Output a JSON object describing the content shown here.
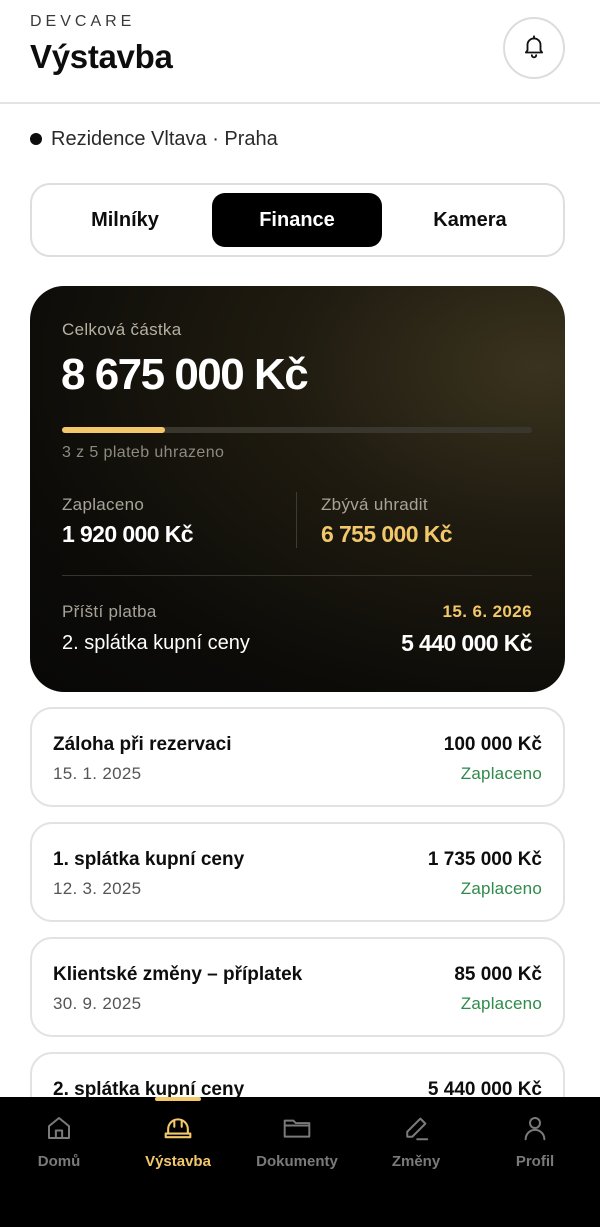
{
  "header": {
    "brand": "DEVCARE",
    "title": "Výstavba"
  },
  "project": {
    "name": "Rezidence Vltava · Praha"
  },
  "tabs": [
    {
      "label": "Milníky",
      "active": false
    },
    {
      "label": "Finance",
      "active": true
    },
    {
      "label": "Kamera",
      "active": false
    }
  ],
  "summary": {
    "total_label": "Celková částka",
    "total": "8 675 000 Kč",
    "progress_fraction": 0.22,
    "progress_text": "3 z 5 plateb uhrazeno",
    "paid_label": "Zaplaceno",
    "paid": "1 920 000 Kč",
    "remaining_label": "Zbývá uhradit",
    "remaining": "6 755 000 Kč",
    "next_label": "Příští platba",
    "next_date": "15. 6. 2026",
    "next_name": "2. splátka kupní ceny",
    "next_amount": "5 440 000 Kč"
  },
  "payments": [
    {
      "name": "Záloha při rezervaci",
      "date": "15. 1. 2025",
      "amount": "100 000 Kč",
      "status": "Zaplaceno"
    },
    {
      "name": "1. splátka kupní ceny",
      "date": "12. 3. 2025",
      "amount": "1 735 000 Kč",
      "status": "Zaplaceno"
    },
    {
      "name": "Klientské změny – příplatek",
      "date": "30. 9. 2025",
      "amount": "85 000 Kč",
      "status": "Zaplaceno"
    },
    {
      "name": "2. splátka kupní ceny",
      "date": "",
      "amount": "5 440 000 Kč",
      "status": ""
    }
  ],
  "nav": [
    {
      "label": "Domů",
      "icon": "home-icon",
      "active": false
    },
    {
      "label": "Výstavba",
      "icon": "hardhat-icon",
      "active": true
    },
    {
      "label": "Dokumenty",
      "icon": "folder-icon",
      "active": false
    },
    {
      "label": "Změny",
      "icon": "pencil-icon",
      "active": false
    },
    {
      "label": "Profil",
      "icon": "user-icon",
      "active": false
    }
  ],
  "colors": {
    "accent": "#f2c86a",
    "paid_status": "#2e8b4a",
    "dark": "#000000"
  }
}
